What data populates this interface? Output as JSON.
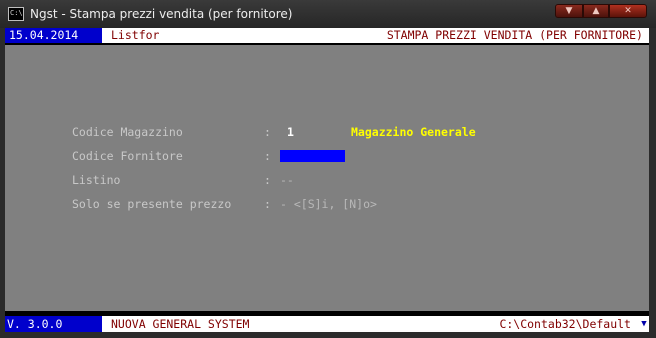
{
  "window": {
    "title": "Ngst - Stampa prezzi vendita (per fornitore)",
    "icon": "console-icon",
    "controls": {
      "minimize_icon": "minimize-icon",
      "maximize_icon": "maximize-icon",
      "close_icon": "close-icon"
    }
  },
  "header": {
    "date": "15.04.2014",
    "program": "Listfor",
    "screen_title": "STAMPA PREZZI VENDITA (PER FORNITORE)"
  },
  "form": {
    "separator": ":",
    "fields": [
      {
        "label": "Codice Magazzino",
        "value": "1",
        "description": "Magazzino Generale"
      },
      {
        "label": "Codice Fornitore",
        "value": ""
      },
      {
        "label": "Listino",
        "value": "--"
      },
      {
        "label": "Solo se presente prezzo",
        "value": "- <[S]i, [N]o>"
      }
    ]
  },
  "footer": {
    "version": "V. 3.0.0",
    "system_name": "NUOVA GENERAL SYSTEM",
    "path": "C:\\Contab32\\Default"
  },
  "colors": {
    "background": "#808080",
    "header_bar": "#ffffff",
    "date_cell": "#0000cc",
    "header_text": "#800000",
    "label_text": "#c8c8c8",
    "description_text": "#ffff00",
    "input_field": "#0000ff"
  }
}
